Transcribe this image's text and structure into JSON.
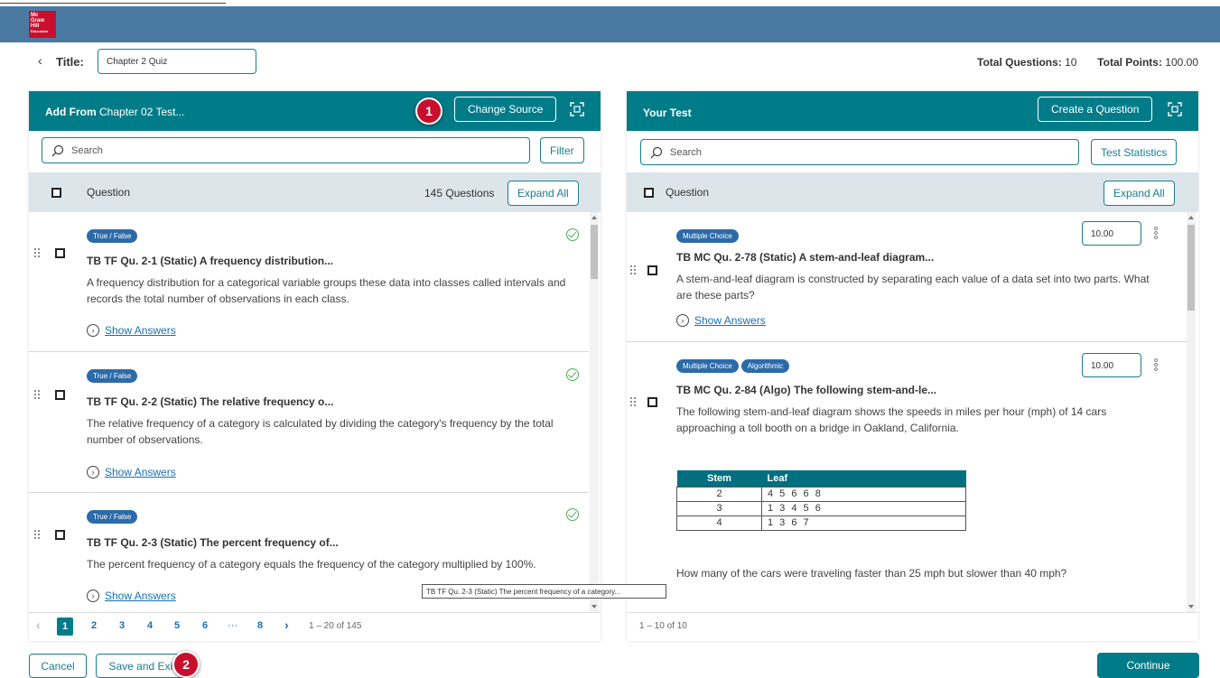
{
  "app": {
    "logo_lines": [
      "Mc",
      "Graw",
      "Hill",
      "Education"
    ]
  },
  "header": {
    "back_glyph": "‹",
    "title_label": "Title:",
    "title_value": "Chapter 2 Quiz",
    "total_questions_label": "Total Questions:",
    "total_questions_value": "10",
    "total_points_label": "Total Points:",
    "total_points_value": "100.00"
  },
  "left": {
    "heading_bold": "Add From",
    "heading_rest": " Chapter 02 Test...",
    "change_source": "Change Source",
    "search_placeholder": "Search",
    "filter": "Filter",
    "col_question": "Question",
    "count": "145 Questions",
    "expand_all": "Expand All",
    "items": [
      {
        "badge": "True / False",
        "title": "TB TF Qu. 2-1 (Static) A frequency distribution...",
        "text": "A frequency distribution for a categorical variable groups these data into classes called intervals and records the total number of observations in each class.",
        "show_answers": "Show Answers"
      },
      {
        "badge": "True / False",
        "title": "TB TF Qu. 2-2 (Static) The relative frequency o...",
        "text": "The relative frequency of a category is calculated by dividing the category's frequency by the total number of observations.",
        "show_answers": "Show Answers"
      },
      {
        "badge": "True / False",
        "title": "TB TF Qu. 2-3 (Static) The percent frequency of...",
        "text": "The percent frequency of a category equals the frequency of the category multiplied by 100%.",
        "show_answers": "Show Answers"
      }
    ],
    "pager": {
      "prev": "‹",
      "pages": [
        "1",
        "2",
        "3",
        "4",
        "5",
        "6",
        "···",
        "8"
      ],
      "next": "›",
      "range": "1 – 20 of 145"
    }
  },
  "right": {
    "heading": "Your Test",
    "create": "Create a Question",
    "search_placeholder": "Search",
    "test_statistics": "Test Statistics",
    "col_question": "Question",
    "expand_all": "Expand All",
    "items": [
      {
        "badges": [
          "Multiple Choice"
        ],
        "points": "10.00",
        "title": "TB MC Qu. 2-78 (Static) A stem-and-leaf diagram...",
        "text": "A stem-and-leaf diagram is constructed by separating each value of a data set into two parts. What are these parts?",
        "show_answers": "Show Answers"
      },
      {
        "badges": [
          "Multiple Choice",
          "Algorithmic"
        ],
        "points": "10.00",
        "title": "TB MC Qu. 2-84 (Algo) The following stem-and-le...",
        "text": "The following stem-and-leaf diagram shows the speeds in miles per hour (mph) of 14 cars approaching a toll booth on a bridge in Oakland, California.",
        "table": {
          "headers": [
            "Stem",
            "Leaf"
          ],
          "rows": [
            [
              "2",
              "4 5 6 6 8"
            ],
            [
              "3",
              "1 3 4 5 6"
            ],
            [
              "4",
              "1 3 6 7"
            ]
          ]
        },
        "question": "How many of the cars were traveling faster than 25 mph but slower than 40 mph?"
      }
    ],
    "range": "1 – 10 of 10"
  },
  "tooltip": "TB TF Qu. 2-3 (Static) The percent frequency of a category...",
  "footer": {
    "cancel": "Cancel",
    "save_exit": "Save and Exit",
    "continue": "Continue"
  },
  "markers": [
    "1",
    "2"
  ],
  "colors": {
    "teal": "#007c89",
    "appbar": "#4a7aa2",
    "badge": "#2d6ba8",
    "marker": "#c8102e"
  }
}
